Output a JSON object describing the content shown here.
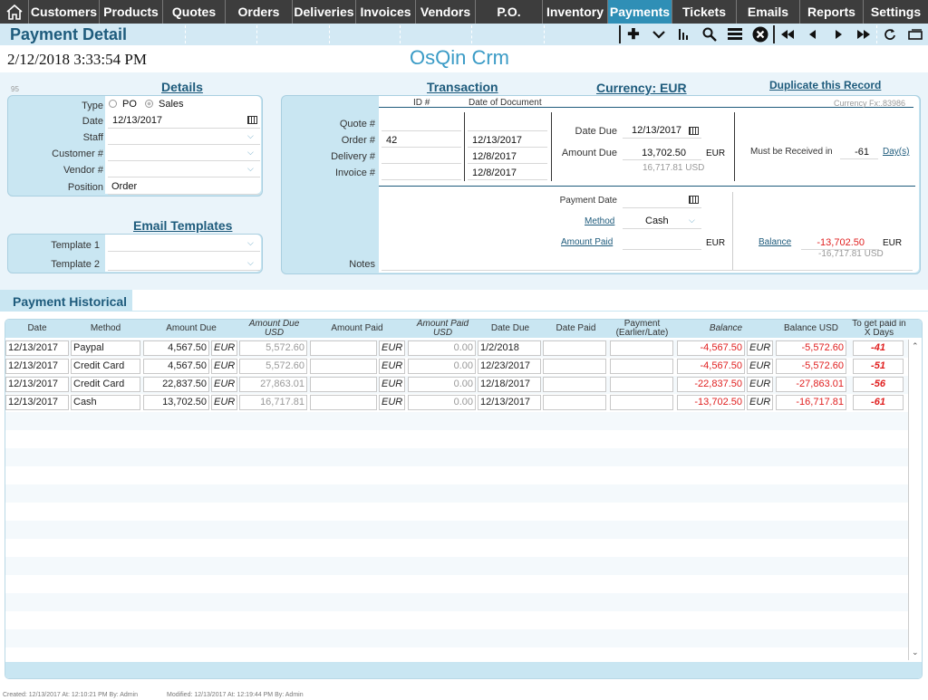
{
  "nav": {
    "home_icon": "home-icon",
    "tabs": [
      "Customers",
      "Products",
      "Quotes",
      "Orders",
      "Deliveries",
      "Invoices",
      "Vendors",
      "P.O.",
      "Inventory",
      "Payments",
      "Tickets",
      "Emails",
      "Reports",
      "Settings"
    ],
    "active": "Payments"
  },
  "header": {
    "title": "Payment Detail",
    "toolbar_icons": [
      "plus-icon",
      "chevron-down-icon",
      "bar-chart-icon",
      "search-icon",
      "list-icon",
      "close-circle-icon",
      "first-record-icon",
      "previous-record-icon",
      "next-record-icon",
      "last-record-icon",
      "refresh-icon",
      "window-icon"
    ]
  },
  "datetime": "2/12/2018 3:33:54 PM",
  "app_name": "OsQin Crm",
  "details": {
    "heading": "Details",
    "record_id": "95",
    "type_label": "Type",
    "type_options": [
      "PO",
      "Sales"
    ],
    "type_selected": "Sales",
    "date_label": "Date",
    "date_value": "12/13/2017",
    "staff_label": "Staff",
    "staff_value": "",
    "customer_label": "Customer #",
    "customer_value": "",
    "vendor_label": "Vendor #",
    "vendor_value": "",
    "position_label": "Position",
    "position_value": "Order"
  },
  "email_templates": {
    "heading": "Email Templates",
    "template1_label": "Template 1",
    "template1_value": "",
    "template2_label": "Template 2",
    "template2_value": ""
  },
  "transaction": {
    "heading": "Transaction",
    "currency_heading": "Currency: EUR",
    "duplicate_link": "Duplicate this Record",
    "currency_fx": "Currency Fx:.83986",
    "col_id": "ID #",
    "col_date": "Date of Document",
    "quote_label": "Quote #",
    "quote_id": "",
    "quote_date": "",
    "order_label": "Order #",
    "order_id": "42",
    "order_date": "12/13/2017",
    "delivery_label": "Delivery #",
    "delivery_id": "",
    "delivery_date": "12/8/2017",
    "invoice_label": "Invoice #",
    "invoice_id": "",
    "invoice_date": "12/8/2017",
    "notes_label": "Notes",
    "date_due_label": "Date Due",
    "date_due_value": "12/13/2017",
    "amount_due_label": "Amount Due",
    "amount_due_value": "13,702.50",
    "amount_due_currency": "EUR",
    "amount_due_usd": "16,717.81 USD",
    "received_label": "Must be Received in",
    "received_value": "-61",
    "received_unit": "Day(s)",
    "payment_date_label": "Payment Date",
    "payment_date_value": "",
    "method_label": "Method",
    "method_value": "Cash",
    "amount_paid_label": "Amount Paid",
    "amount_paid_value": "",
    "amount_paid_currency": "EUR",
    "balance_label": "Balance",
    "balance_value": "-13,702.50",
    "balance_currency": "EUR",
    "balance_usd": "-16,717.81 USD"
  },
  "history": {
    "tab_label": "Payment Historical",
    "columns": {
      "date": "Date",
      "method": "Method",
      "amount_due": "Amount Due",
      "amount_due_usd": "Amount Due USD",
      "amount_paid": "Amount Paid",
      "amount_paid_usd": "Amount Paid USD",
      "date_due": "Date Due",
      "date_paid": "Date Paid",
      "payment_timing": "Payment (Earlier/Late)",
      "balance": "Balance",
      "balance_usd": "Balance USD",
      "days": "To get paid in X Days"
    },
    "rows": [
      {
        "date": "12/13/2017",
        "method": "Paypal",
        "amount_due": "4,567.50",
        "cur1": "EUR",
        "amount_due_usd": "5,572.60",
        "amount_paid": "",
        "cur2": "EUR",
        "amount_paid_usd": "0.00",
        "date_due": "1/2/2018",
        "date_paid": "",
        "timing": "",
        "balance": "-4,567.50",
        "cur3": "EUR",
        "balance_usd": "-5,572.60",
        "days": "-41"
      },
      {
        "date": "12/13/2017",
        "method": "Credit Card",
        "amount_due": "4,567.50",
        "cur1": "EUR",
        "amount_due_usd": "5,572.60",
        "amount_paid": "",
        "cur2": "EUR",
        "amount_paid_usd": "0.00",
        "date_due": "12/23/2017",
        "date_paid": "",
        "timing": "",
        "balance": "-4,567.50",
        "cur3": "EUR",
        "balance_usd": "-5,572.60",
        "days": "-51"
      },
      {
        "date": "12/13/2017",
        "method": "Credit Card",
        "amount_due": "22,837.50",
        "cur1": "EUR",
        "amount_due_usd": "27,863.01",
        "amount_paid": "",
        "cur2": "EUR",
        "amount_paid_usd": "0.00",
        "date_due": "12/18/2017",
        "date_paid": "",
        "timing": "",
        "balance": "-22,837.50",
        "cur3": "EUR",
        "balance_usd": "-27,863.01",
        "days": "-56"
      },
      {
        "date": "12/13/2017",
        "method": "Cash",
        "amount_due": "13,702.50",
        "cur1": "EUR",
        "amount_due_usd": "16,717.81",
        "amount_paid": "",
        "cur2": "EUR",
        "amount_paid_usd": "0.00",
        "date_due": "12/13/2017",
        "date_paid": "",
        "timing": "",
        "balance": "-13,702.50",
        "cur3": "EUR",
        "balance_usd": "-16,717.81",
        "days": "-61"
      }
    ]
  },
  "footer": {
    "created": "Created: 12/13/2017   At: 12:10:21 PM   By: Admin",
    "modified": "Modified: 12/13/2017   At: 12:19:44 PM   By: Admin"
  }
}
